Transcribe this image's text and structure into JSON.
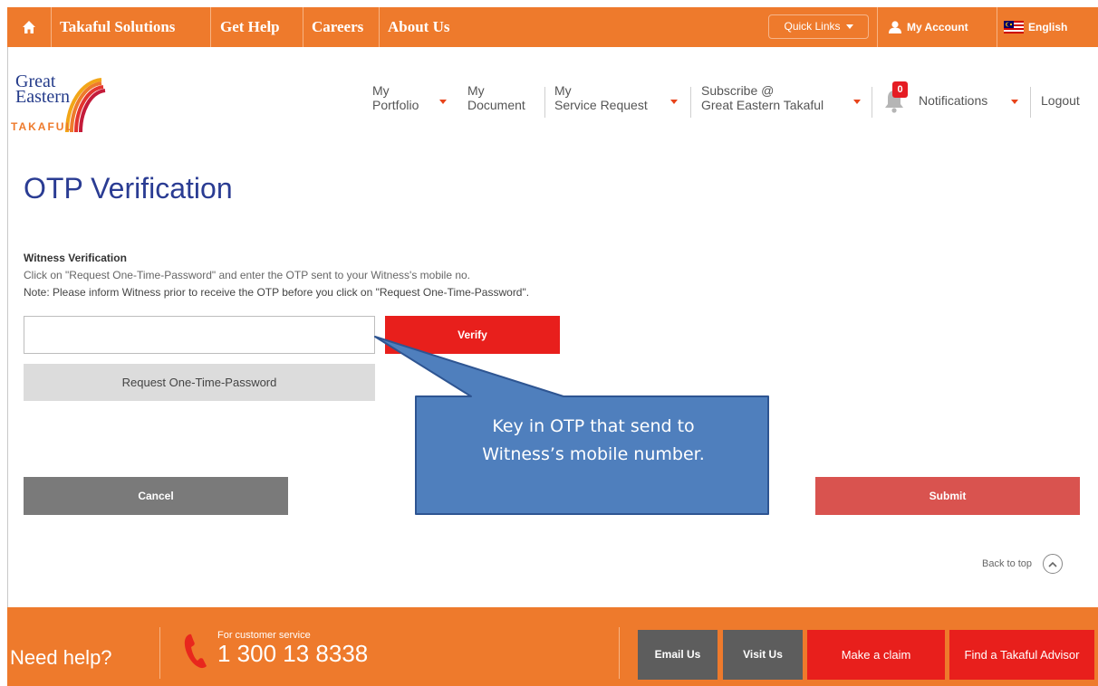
{
  "topbar": {
    "links": [
      "Takaful Solutions",
      "Get Help",
      "Careers",
      "About Us"
    ],
    "quick_links": "Quick Links",
    "my_account": "My Account",
    "language": "English"
  },
  "logo": {
    "line1": "Great",
    "line2": "Eastern",
    "line3": "TAKAFUL"
  },
  "nav": {
    "portfolio_1": "My",
    "portfolio_2": "Portfolio",
    "document_1": "My",
    "document_2": "Document",
    "service_1": "My",
    "service_2": "Service Request",
    "subscribe_1": "Subscribe @",
    "subscribe_2": "Great Eastern Takaful",
    "notification_count": "0",
    "notifications": "Notifications",
    "logout": "Logout"
  },
  "page": {
    "title": "OTP Verification",
    "section_title": "Witness Verification",
    "instruction": "Click on \"Request One-Time-Password\" and enter the OTP sent to your Witness's mobile no.",
    "note": "Note: Please inform Witness prior to receive the OTP before you click on \"Request One-Time-Password\".",
    "otp_value": "",
    "otp_placeholder": "",
    "verify_label": "Verify",
    "request_otp_label": "Request One-Time-Password",
    "cancel_label": "Cancel",
    "submit_label": "Submit",
    "back_to_top": "Back to top"
  },
  "callout": {
    "line1": "Key in OTP that send to",
    "line2": "Witness’s mobile number."
  },
  "footer": {
    "need_help": "Need help?",
    "cs_label": "For customer service",
    "cs_number": "1 300 13 8338",
    "email_us": "Email Us",
    "visit_us": "Visit Us",
    "make_claim": "Make a claim",
    "find_advisor": "Find a Takaful Advisor"
  },
  "colors": {
    "brand_orange": "#ee7a2c",
    "title_blue": "#2a3c93",
    "verify_red": "#e81f1c",
    "submit_red": "#d9534f",
    "callout_blue": "#4f7fbd"
  }
}
